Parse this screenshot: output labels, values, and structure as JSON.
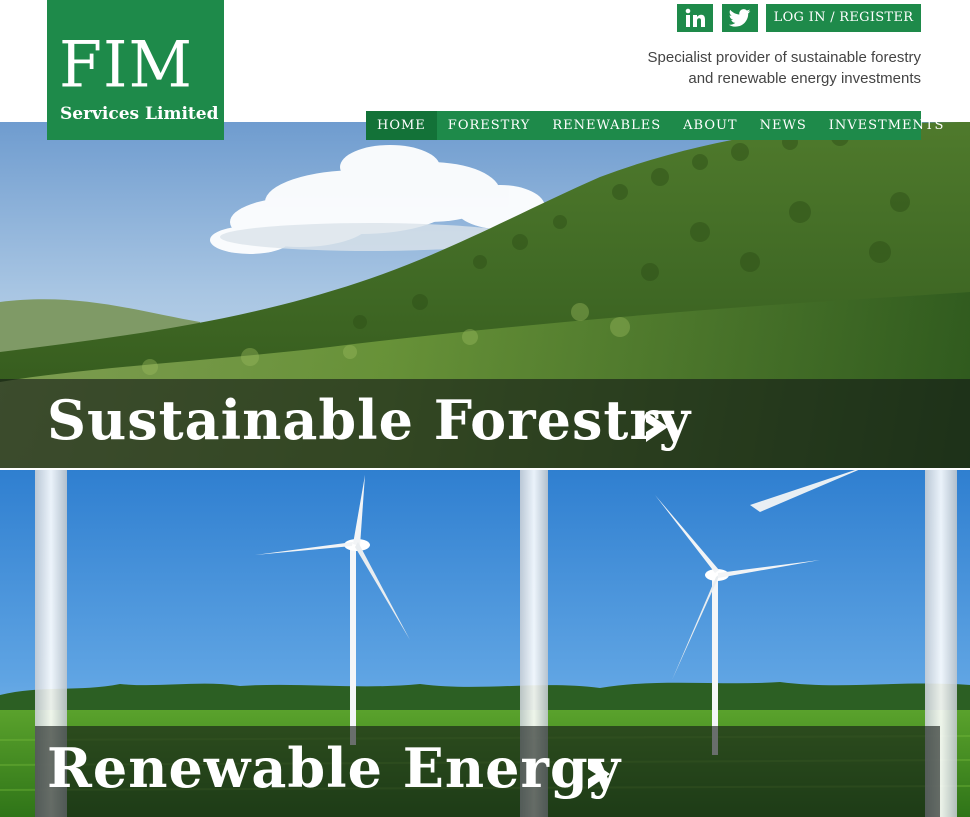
{
  "brand": {
    "name": "FIM",
    "subtitle": "Services Limited",
    "color": "#1e8a4a"
  },
  "header": {
    "social": [
      {
        "name": "linkedin",
        "icon": "linkedin-icon"
      },
      {
        "name": "twitter",
        "icon": "twitter-icon"
      }
    ],
    "login_label": "LOG IN / REGISTER",
    "tagline_line1": "Specialist provider of sustainable forestry",
    "tagline_line2": "and renewable energy investments"
  },
  "nav": {
    "items": [
      {
        "label": "HOME",
        "active": true
      },
      {
        "label": "FORESTRY",
        "active": false
      },
      {
        "label": "RENEWABLES",
        "active": false
      },
      {
        "label": "ABOUT",
        "active": false
      },
      {
        "label": "NEWS",
        "active": false
      },
      {
        "label": "INVESTMENTS",
        "active": false
      }
    ]
  },
  "banners": [
    {
      "title": "Sustainable Forestry",
      "icon": "chevron-right-icon"
    },
    {
      "title": "Renewable Energy",
      "icon": "chevron-right-icon"
    }
  ]
}
